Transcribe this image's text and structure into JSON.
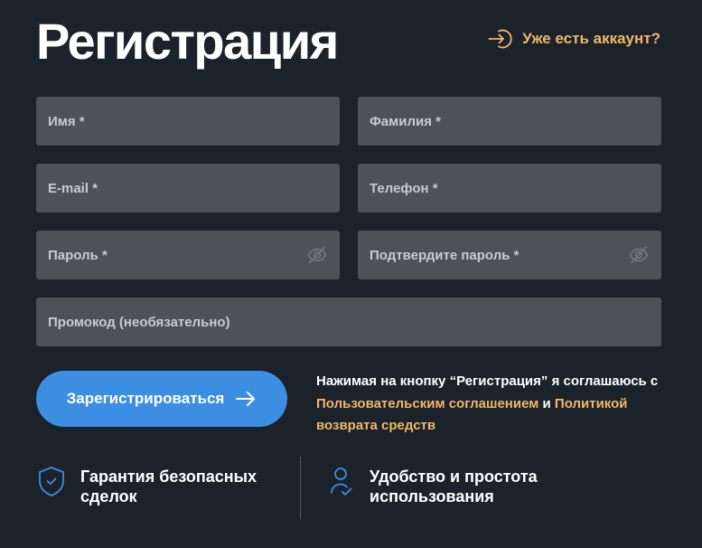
{
  "page": {
    "title": "Регистрация",
    "login_link": "Уже есть аккаунт?"
  },
  "form": {
    "first_name": {
      "placeholder": "Имя *",
      "value": ""
    },
    "last_name": {
      "placeholder": "Фамилия *",
      "value": ""
    },
    "email": {
      "placeholder": "E-mail *",
      "value": ""
    },
    "phone": {
      "placeholder": "Телефон *",
      "value": ""
    },
    "password": {
      "placeholder": "Пароль *",
      "value": ""
    },
    "password_confirm": {
      "placeholder": "Подтвердите пароль *",
      "value": ""
    },
    "promo": {
      "placeholder": "Промокод (необязательно)",
      "value": ""
    },
    "submit_label": "Зарегистрироваться"
  },
  "agreement": {
    "text_before": "Нажимая на кнопку “Регистрация” я соглашаюсь с",
    "user_agreement_link": "Пользовательским соглашением",
    "conjunction": "и",
    "refund_policy_link": "Политикой возврата средств"
  },
  "features": [
    {
      "icon": "shield-check-icon",
      "line1": "Гарантия безопасных",
      "line2": "сделок"
    },
    {
      "icon": "user-check-icon",
      "line1": "Удобство и простота",
      "line2": "использования"
    }
  ],
  "colors": {
    "background": "#1b2229",
    "field": "#4b5359",
    "accent": "#f2b76a",
    "primary": "#3c8ee3",
    "icon_blue": "#3c8ee3"
  }
}
